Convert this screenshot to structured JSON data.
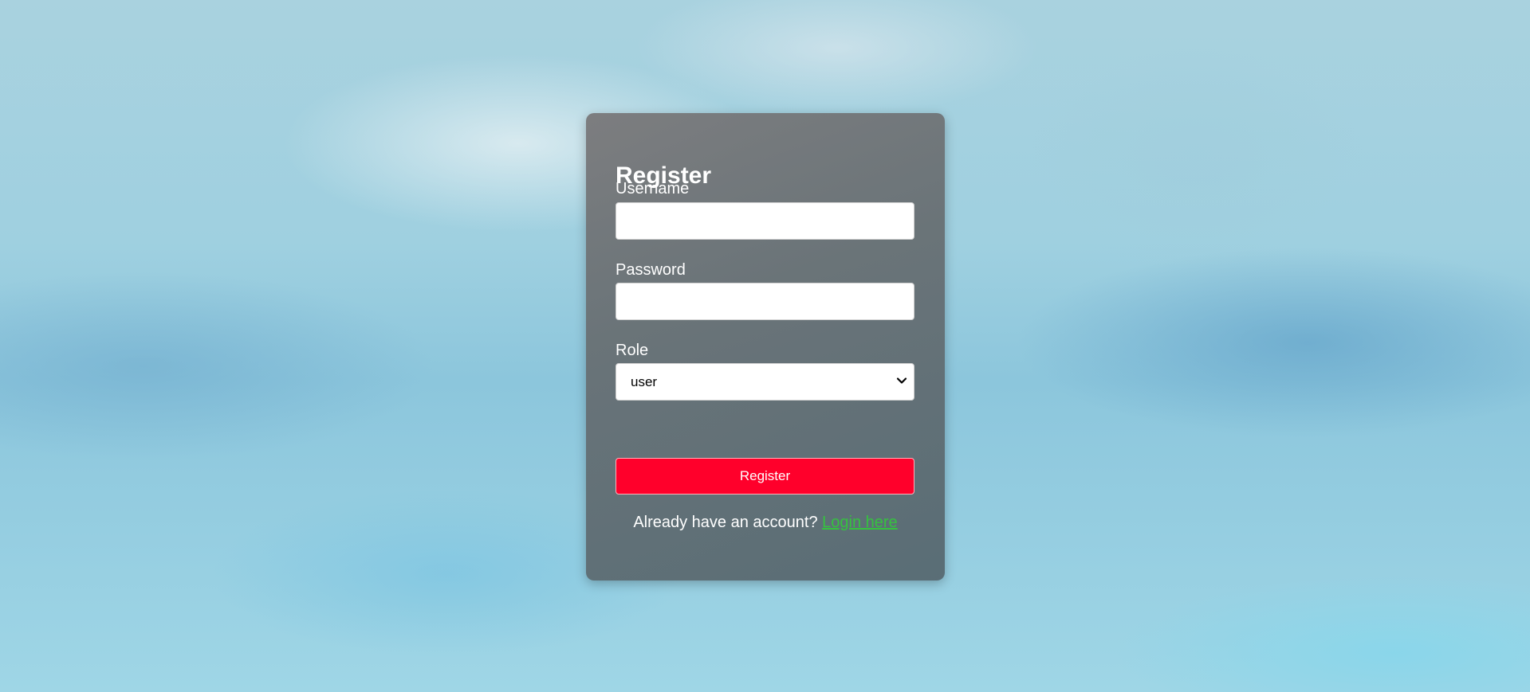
{
  "form": {
    "title": "Register",
    "username_label": "Username",
    "username_value": "",
    "password_label": "Password",
    "password_value": "",
    "role_label": "Role",
    "role_selected": "user",
    "submit_label": "Register",
    "footer_text": "Already have an account?",
    "login_link_label": "Login here"
  },
  "icons": {
    "select_chevron": "chevron-down-icon"
  },
  "colors": {
    "submit_button": "#ff002b",
    "login_link": "#35c23f",
    "card_background": "#6b7378"
  }
}
